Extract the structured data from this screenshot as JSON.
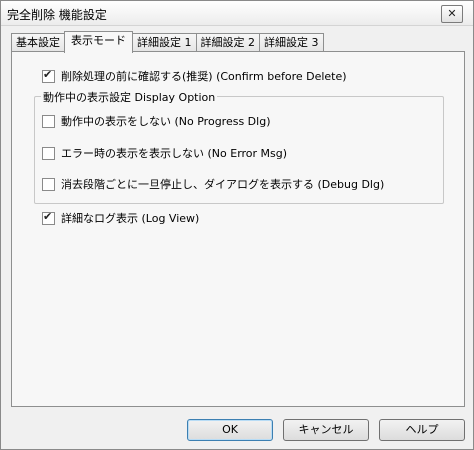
{
  "window": {
    "title": "完全削除 機能設定",
    "close_glyph": "✕"
  },
  "tabs": [
    {
      "label": "基本設定",
      "active": false
    },
    {
      "label": "表示モード",
      "active": true
    },
    {
      "label": "詳細設定 1",
      "active": false
    },
    {
      "label": "詳細設定 2",
      "active": false
    },
    {
      "label": "詳細設定 3",
      "active": false
    }
  ],
  "options": {
    "confirm_delete": {
      "label": "削除処理の前に確認する(推奨) (Confirm before Delete)",
      "checked": true
    },
    "display_group": {
      "legend": "動作中の表示設定  Display Option",
      "no_progress": {
        "label": "動作中の表示をしない (No Progress Dlg)",
        "checked": false
      },
      "no_error": {
        "label": "エラー時の表示を表示しない  (No Error Msg)",
        "checked": false
      },
      "debug_dlg": {
        "label": "消去段階ごとに一旦停止し、ダイアログを表示する (Debug Dlg)",
        "checked": false
      }
    },
    "log_view": {
      "label": "詳細なログ表示 (Log View)",
      "checked": true
    }
  },
  "buttons": {
    "ok": "OK",
    "cancel": "キャンセル",
    "help": "ヘルプ"
  }
}
